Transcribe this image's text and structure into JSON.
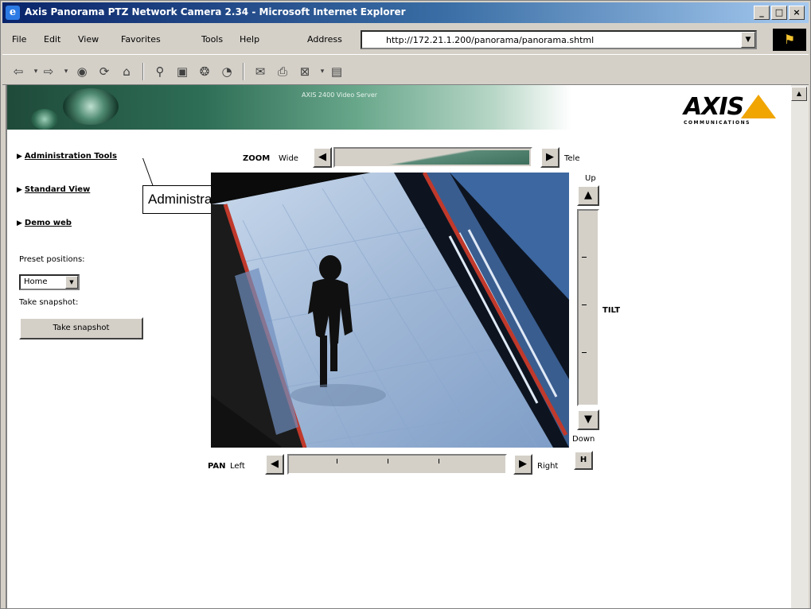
{
  "window": {
    "title": "Axis Panorama PTZ Network Camera 2.34 - Microsoft Internet Explorer",
    "min": "_",
    "max": "□",
    "close": "×"
  },
  "menu": {
    "file": "File",
    "edit": "Edit",
    "view": "View",
    "favorites": "Favorites",
    "tools": "Tools",
    "help": "Help",
    "address_label": "Address",
    "address_value": "http://172.21.1.200/panorama/panorama.shtml"
  },
  "banner": {
    "logo": "AXIS",
    "logo_sub": "COMMUNICATIONS",
    "caption": "AXIS 2400 Video Server"
  },
  "nav": {
    "admin": "Administration Tools",
    "standard": "Standard View",
    "demo": "Demo web"
  },
  "preset": {
    "label": "Preset positions:",
    "value": "Home"
  },
  "snapshot": {
    "label": "Take snapshot:",
    "button": "Take snapshot"
  },
  "tooltip": {
    "text": "Administration Tools"
  },
  "zoom": {
    "label": "ZOOM",
    "wide": "Wide",
    "tele": "Tele"
  },
  "tilt": {
    "label": "TILT",
    "up": "Up",
    "down": "Down"
  },
  "pan": {
    "label": "PAN",
    "left": "Left",
    "right": "Right",
    "home": "H"
  },
  "colors": {
    "brand_orange": "#f0a500",
    "titlebar": "#0a246a",
    "banner_green": "#2e6e56",
    "railing_red": "#c0392b"
  }
}
